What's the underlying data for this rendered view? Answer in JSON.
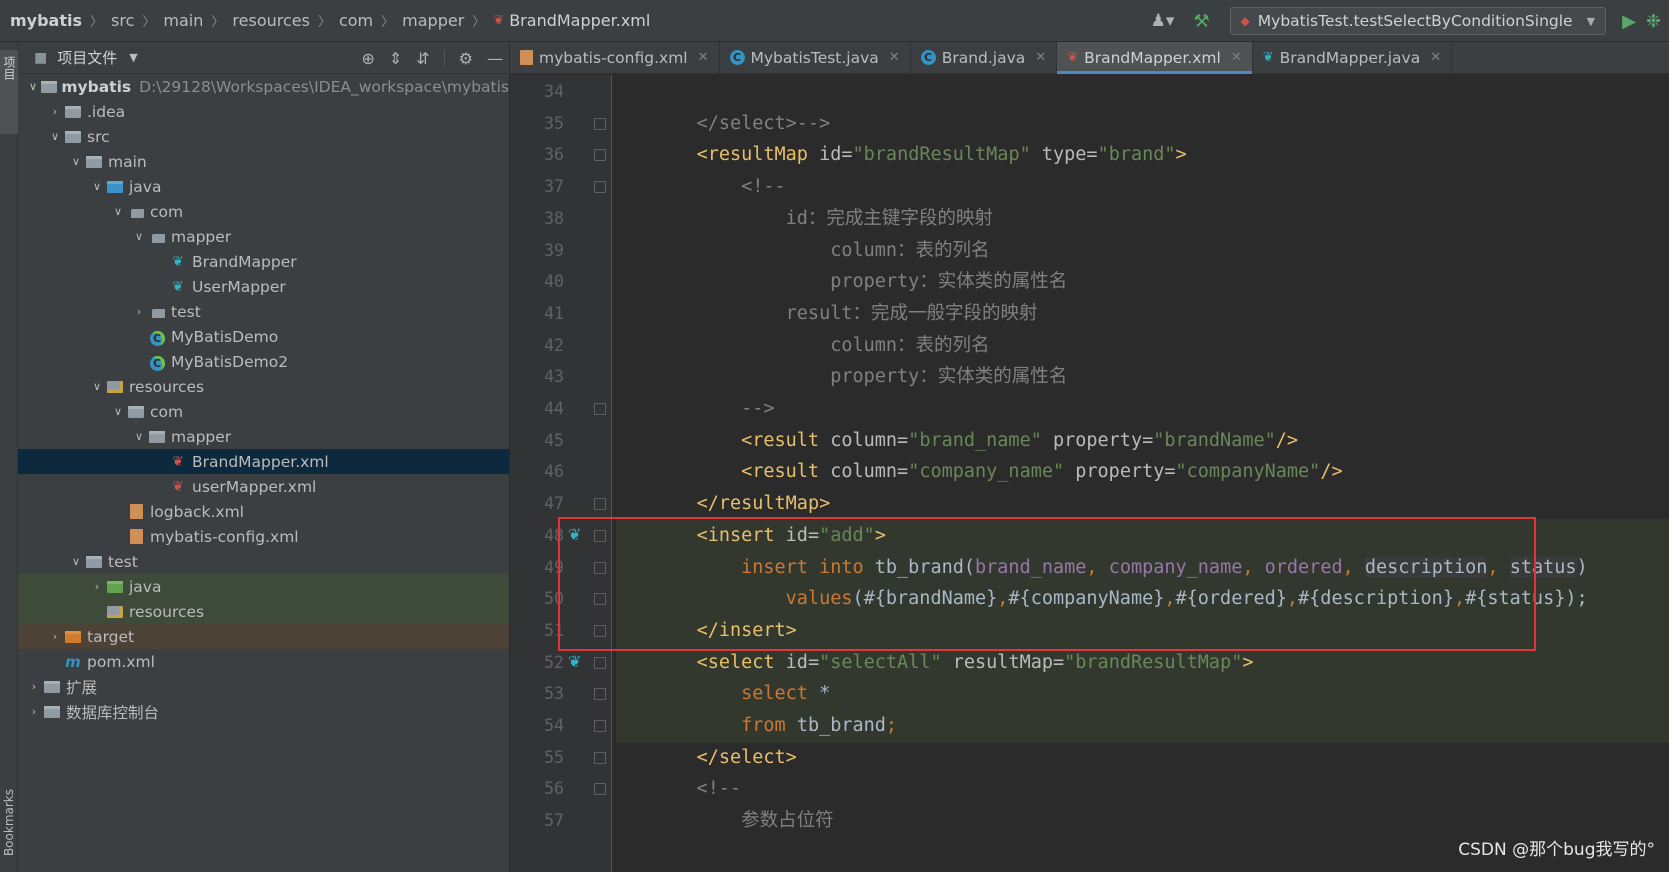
{
  "navbar": {
    "breadcrumbs": [
      "mybatis",
      "src",
      "main",
      "resources",
      "com",
      "mapper"
    ],
    "current_file": "BrandMapper.xml",
    "run_config": "MybatisTest.testSelectByConditionSingle"
  },
  "tool_stripe": {
    "project_label": "项目",
    "bookmarks_label": "Bookmarks"
  },
  "project_panel": {
    "title": "项目文件",
    "tree": [
      {
        "name": "mybatis",
        "path": "D:\\29128\\Workspaces\\IDEA_workspace\\mybatis",
        "depth": 0,
        "arrow": "down",
        "icon": "folder",
        "bold": true
      },
      {
        "name": ".idea",
        "depth": 1,
        "arrow": "right",
        "icon": "folder"
      },
      {
        "name": "src",
        "depth": 1,
        "arrow": "down",
        "icon": "folder"
      },
      {
        "name": "main",
        "depth": 2,
        "arrow": "down",
        "icon": "folder"
      },
      {
        "name": "java",
        "depth": 3,
        "arrow": "down",
        "icon": "folder-blue"
      },
      {
        "name": "com",
        "depth": 4,
        "arrow": "down",
        "icon": "pkg"
      },
      {
        "name": "mapper",
        "depth": 5,
        "arrow": "down",
        "icon": "pkg"
      },
      {
        "name": "BrandMapper",
        "depth": 6,
        "arrow": "none",
        "icon": "bird"
      },
      {
        "name": "UserMapper",
        "depth": 6,
        "arrow": "none",
        "icon": "bird"
      },
      {
        "name": "test",
        "depth": 5,
        "arrow": "right",
        "icon": "pkg"
      },
      {
        "name": "MyBatisDemo",
        "depth": 5,
        "arrow": "none",
        "icon": "class"
      },
      {
        "name": "MyBatisDemo2",
        "depth": 5,
        "arrow": "none",
        "icon": "class"
      },
      {
        "name": "resources",
        "depth": 3,
        "arrow": "down",
        "icon": "res"
      },
      {
        "name": "com",
        "depth": 4,
        "arrow": "down",
        "icon": "folder"
      },
      {
        "name": "mapper",
        "depth": 5,
        "arrow": "down",
        "icon": "folder"
      },
      {
        "name": "BrandMapper.xml",
        "depth": 6,
        "arrow": "none",
        "icon": "xmlbird",
        "state": "selected"
      },
      {
        "name": "userMapper.xml",
        "depth": 6,
        "arrow": "none",
        "icon": "xmlbird"
      },
      {
        "name": "logback.xml",
        "depth": 4,
        "arrow": "none",
        "icon": "xmlfile"
      },
      {
        "name": "mybatis-config.xml",
        "depth": 4,
        "arrow": "none",
        "icon": "xmlfile"
      },
      {
        "name": "test",
        "depth": 2,
        "arrow": "down",
        "icon": "folder"
      },
      {
        "name": "java",
        "depth": 3,
        "arrow": "right",
        "icon": "folder-green",
        "state": "green"
      },
      {
        "name": "resources",
        "depth": 3,
        "arrow": "none",
        "icon": "res",
        "state": "green"
      },
      {
        "name": "target",
        "depth": 1,
        "arrow": "right",
        "icon": "folder-orange",
        "state": "orange"
      },
      {
        "name": "pom.xml",
        "depth": 1,
        "arrow": "none",
        "icon": "maven"
      },
      {
        "name": "扩展",
        "depth": 0,
        "arrow": "right",
        "icon": "folder"
      },
      {
        "name": "数据库控制台",
        "depth": 0,
        "arrow": "right",
        "icon": "folder"
      }
    ]
  },
  "tabs": [
    {
      "label": "mybatis-config.xml",
      "icon": "xml",
      "active": false
    },
    {
      "label": "MybatisTest.java",
      "icon": "class",
      "active": false
    },
    {
      "label": "Brand.java",
      "icon": "class",
      "active": false
    },
    {
      "label": "BrandMapper.xml",
      "icon": "bird",
      "active": true
    },
    {
      "label": "BrandMapper.java",
      "icon": "bird2",
      "active": false
    }
  ],
  "editor": {
    "lines": [
      {
        "n": "34",
        "tokens": []
      },
      {
        "n": "35",
        "fold": true,
        "tokens": [
          [
            "    </select>-->",
            "cmt"
          ]
        ]
      },
      {
        "n": "36",
        "fold": true,
        "tokens": [
          [
            "    ",
            "plain"
          ],
          [
            "<resultMap ",
            "tag"
          ],
          [
            "id=",
            "attr"
          ],
          [
            "\"brandResultMap\" ",
            "val"
          ],
          [
            "type=",
            "attr"
          ],
          [
            "\"brand\"",
            "val"
          ],
          [
            ">",
            "tag"
          ]
        ]
      },
      {
        "n": "37",
        "fold": true,
        "tokens": [
          [
            "        <!--",
            "cmt"
          ]
        ]
      },
      {
        "n": "38",
        "tokens": [
          [
            "            id：完成主键字段的映射",
            "cmt"
          ]
        ]
      },
      {
        "n": "39",
        "tokens": [
          [
            "                column：表的列名",
            "cmt"
          ]
        ]
      },
      {
        "n": "40",
        "tokens": [
          [
            "                property：实体类的属性名",
            "cmt"
          ]
        ]
      },
      {
        "n": "41",
        "tokens": [
          [
            "            result：完成一般字段的映射",
            "cmt"
          ]
        ]
      },
      {
        "n": "42",
        "tokens": [
          [
            "                column：表的列名",
            "cmt"
          ]
        ]
      },
      {
        "n": "43",
        "tokens": [
          [
            "                property：实体类的属性名",
            "cmt"
          ]
        ]
      },
      {
        "n": "44",
        "fold": true,
        "tokens": [
          [
            "        -->",
            "cmt"
          ]
        ]
      },
      {
        "n": "45",
        "tokens": [
          [
            "        ",
            "plain"
          ],
          [
            "<result ",
            "tag"
          ],
          [
            "column=",
            "attr"
          ],
          [
            "\"brand_name\" ",
            "val"
          ],
          [
            "property=",
            "attr"
          ],
          [
            "\"brandName\"",
            "val"
          ],
          [
            "/>",
            "tag"
          ]
        ]
      },
      {
        "n": "46",
        "tokens": [
          [
            "        ",
            "plain"
          ],
          [
            "<result ",
            "tag"
          ],
          [
            "column=",
            "attr"
          ],
          [
            "\"company_name\" ",
            "val"
          ],
          [
            "property=",
            "attr"
          ],
          [
            "\"companyName\"",
            "val"
          ],
          [
            "/>",
            "tag"
          ]
        ]
      },
      {
        "n": "47",
        "fold": true,
        "tokens": [
          [
            "    ",
            "plain"
          ],
          [
            "</resultMap>",
            "tag"
          ]
        ]
      },
      {
        "n": "48",
        "mark": true,
        "fold": true,
        "hl": true,
        "tokens": [
          [
            "    ",
            "plain"
          ],
          [
            "<insert ",
            "tag"
          ],
          [
            "id=",
            "attr"
          ],
          [
            "\"add\"",
            "val"
          ],
          [
            ">",
            "tag"
          ]
        ]
      },
      {
        "n": "49",
        "fold": true,
        "hl": true,
        "tokens": [
          [
            "        ",
            "plain"
          ],
          [
            "insert into ",
            "kw"
          ],
          [
            "tb_brand(",
            "plain"
          ],
          [
            "brand_name",
            "col"
          ],
          [
            ", ",
            "kw"
          ],
          [
            "company_name",
            "col"
          ],
          [
            ", ",
            "kw"
          ],
          [
            "ordered",
            "col"
          ],
          [
            ", ",
            "kw"
          ],
          [
            "description",
            "boxed"
          ],
          [
            ", ",
            "kw"
          ],
          [
            "status",
            "boxed"
          ],
          [
            ")",
            "plain"
          ]
        ]
      },
      {
        "n": "50",
        "fold": true,
        "hl": true,
        "tokens": [
          [
            "            ",
            "plain"
          ],
          [
            "values",
            "kw"
          ],
          [
            "(#{brandName}",
            "plain"
          ],
          [
            ",",
            "kw"
          ],
          [
            "#{companyName}",
            "plain"
          ],
          [
            ",",
            "kw"
          ],
          [
            "#{ordered}",
            "plain"
          ],
          [
            ",",
            "kw"
          ],
          [
            "#{description}",
            "plain"
          ],
          [
            ",",
            "kw"
          ],
          [
            "#{status});",
            "plain"
          ]
        ]
      },
      {
        "n": "51",
        "fold": true,
        "hl": true,
        "tokens": [
          [
            "    ",
            "plain"
          ],
          [
            "</insert>",
            "tag"
          ]
        ]
      },
      {
        "n": "52",
        "mark": true,
        "fold": true,
        "hl": true,
        "tokens": [
          [
            "    ",
            "plain"
          ],
          [
            "<select ",
            "tag"
          ],
          [
            "id=",
            "attr"
          ],
          [
            "\"selectAll\" ",
            "val"
          ],
          [
            "resultMap=",
            "attr"
          ],
          [
            "\"brandResultMap\"",
            "val"
          ],
          [
            ">",
            "tag"
          ]
        ]
      },
      {
        "n": "53",
        "fold": true,
        "hl": true,
        "tokens": [
          [
            "        ",
            "plain"
          ],
          [
            "select ",
            "kw"
          ],
          [
            "*",
            "plain"
          ]
        ]
      },
      {
        "n": "54",
        "fold": true,
        "hl": true,
        "tokens": [
          [
            "        ",
            "plain"
          ],
          [
            "from ",
            "kw"
          ],
          [
            "tb_brand",
            "plain"
          ],
          [
            ";",
            "kw"
          ]
        ]
      },
      {
        "n": "55",
        "fold": true,
        "tokens": [
          [
            "    ",
            "plain"
          ],
          [
            "</select>",
            "tag"
          ]
        ]
      },
      {
        "n": "56",
        "fold": true,
        "tokens": [
          [
            "    <!--",
            "cmt"
          ]
        ]
      },
      {
        "n": "57",
        "tokens": [
          [
            "        参数占位符",
            "cmt"
          ]
        ]
      }
    ]
  },
  "watermark": "CSDN @那个bug我写的°"
}
